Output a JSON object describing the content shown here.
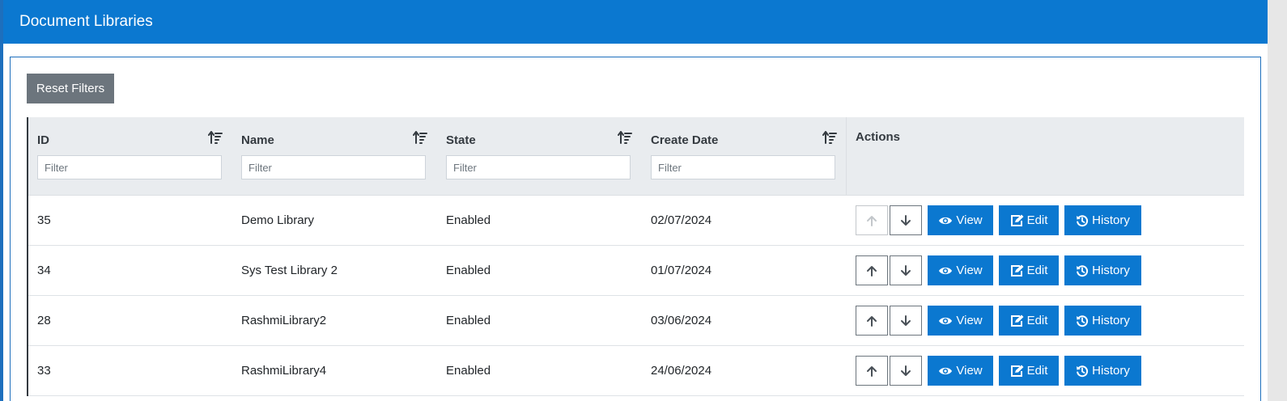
{
  "header": {
    "title": "Document Libraries"
  },
  "toolbar": {
    "reset_label": "Reset Filters"
  },
  "table": {
    "columns": [
      {
        "key": "id",
        "label": "ID",
        "placeholder": "Filter"
      },
      {
        "key": "name",
        "label": "Name",
        "placeholder": "Filter"
      },
      {
        "key": "state",
        "label": "State",
        "placeholder": "Filter"
      },
      {
        "key": "create_date",
        "label": "Create Date",
        "placeholder": "Filter"
      }
    ],
    "actions_label": "Actions",
    "rows": [
      {
        "id": "35",
        "name": "Demo Library",
        "state": "Enabled",
        "create_date": "02/07/2024",
        "move_up_enabled": false
      },
      {
        "id": "34",
        "name": "Sys Test Library 2",
        "state": "Enabled",
        "create_date": "01/07/2024",
        "move_up_enabled": true
      },
      {
        "id": "28",
        "name": "RashmiLibrary2",
        "state": "Enabled",
        "create_date": "03/06/2024",
        "move_up_enabled": true
      },
      {
        "id": "33",
        "name": "RashmiLibrary4",
        "state": "Enabled",
        "create_date": "24/06/2024",
        "move_up_enabled": true
      }
    ],
    "row_actions": {
      "view": "View",
      "edit": "Edit",
      "history": "History"
    }
  },
  "icons": {
    "sort": "sort-icon",
    "up": "arrow-up-icon",
    "down": "arrow-down-icon",
    "view": "eye-icon",
    "edit": "edit-icon",
    "history": "history-icon"
  },
  "colors": {
    "primary": "#0b78d0",
    "secondary": "#6c757d",
    "header_bg": "#e9ecef"
  }
}
